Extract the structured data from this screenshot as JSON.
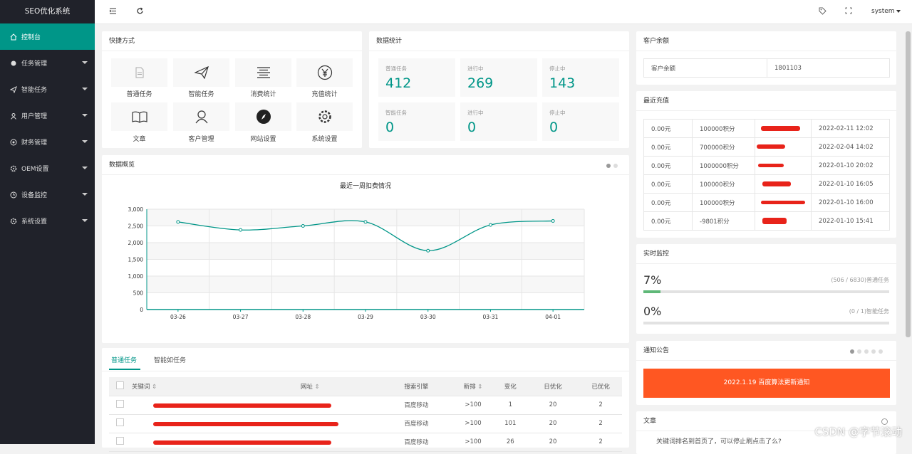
{
  "app": {
    "title": "SEO优化系统"
  },
  "sidebar": {
    "items": [
      {
        "label": "控制台",
        "icon": "home-icon",
        "active": true
      },
      {
        "label": "任务管理",
        "icon": "dot-icon"
      },
      {
        "label": "智能任务",
        "icon": "send-icon"
      },
      {
        "label": "用户管理",
        "icon": "user-icon"
      },
      {
        "label": "财务管理",
        "icon": "coin-icon"
      },
      {
        "label": "OEM设置",
        "icon": "gear-icon"
      },
      {
        "label": "设备监控",
        "icon": "monitor-icon"
      },
      {
        "label": "系统设置",
        "icon": "gear-icon"
      }
    ]
  },
  "header": {
    "user": "system"
  },
  "quick": {
    "title": "快捷方式",
    "items": [
      "普通任务",
      "智能任务",
      "消费统计",
      "充值统计",
      "文章",
      "客户管理",
      "网站设置",
      "系统设置"
    ]
  },
  "stats": {
    "title": "数据统计",
    "items": [
      {
        "label": "普通任务",
        "value": "412"
      },
      {
        "label": "进行中",
        "value": "269"
      },
      {
        "label": "停止中",
        "value": "143"
      },
      {
        "label": "智能任务",
        "value": "0"
      },
      {
        "label": "进行中",
        "value": "0"
      },
      {
        "label": "停止中",
        "value": "0"
      }
    ]
  },
  "overview": {
    "title": "数据概览"
  },
  "chart_data": {
    "type": "line",
    "title": "最近一周扣费情况",
    "categories": [
      "03-26",
      "03-27",
      "03-28",
      "03-29",
      "03-30",
      "03-31",
      "04-01"
    ],
    "values": [
      2620,
      2380,
      2500,
      2620,
      1760,
      2530,
      2650
    ],
    "ylim": [
      0,
      3000
    ],
    "yticks": [
      "0",
      "500",
      "1,000",
      "1,500",
      "2,000",
      "2,500",
      "3,000"
    ],
    "color": "#009688"
  },
  "balance": {
    "title": "客户余额",
    "label": "客户余额",
    "value": "1801103"
  },
  "recharge": {
    "title": "最近充值",
    "rows": [
      {
        "amount": "0.00元",
        "points": "100000积分",
        "time": "2022-02-11 12:02"
      },
      {
        "amount": "0.00元",
        "points": "700000积分",
        "time": "2022-02-04 14:02"
      },
      {
        "amount": "0.00元",
        "points": "1000000积分",
        "time": "2022-01-10 20:02"
      },
      {
        "amount": "0.00元",
        "points": "100000积分",
        "time": "2022-01-10 16:05"
      },
      {
        "amount": "0.00元",
        "points": "100000积分",
        "time": "2022-01-10 16:00"
      },
      {
        "amount": "0.00元",
        "points": "-9801积分",
        "time": "2022-01-10 15:41"
      }
    ]
  },
  "monitor": {
    "title": "实时监控",
    "rows": [
      {
        "percent": "7%",
        "detail": "(506 / 6830)普通任务",
        "fill": 0.07
      },
      {
        "percent": "0%",
        "detail": "(0 / 1)智能任务",
        "fill": 0
      }
    ]
  },
  "notice": {
    "title": "通知公告",
    "button": "2022.1.19 百度算法更新通知"
  },
  "article": {
    "title": "文章",
    "text": "关键词排名到首页了，可以停止刷点击了么?"
  },
  "tasks": {
    "tabs": [
      "普通任务",
      "智能如任务"
    ],
    "headers": [
      "关键词",
      "网址",
      "搜索引擎",
      "新排",
      "变化",
      "日优化",
      "已优化"
    ],
    "rows": [
      {
        "engine": "百度移动",
        "rank": ">100",
        "change": "1",
        "daily": "20",
        "done": "2"
      },
      {
        "engine": "百度移动",
        "rank": ">100",
        "change": "101",
        "daily": "20",
        "done": "2"
      },
      {
        "engine": "百度移动",
        "rank": ">100",
        "change": "26",
        "daily": "20",
        "done": "2"
      }
    ]
  },
  "watermark": "CSDN @字节滚动"
}
